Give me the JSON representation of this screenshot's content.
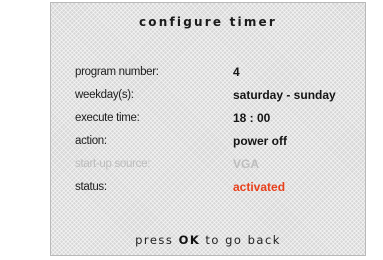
{
  "title": "configure timer",
  "rows": [
    {
      "label": "program number:",
      "value": "4"
    },
    {
      "label": "weekday(s):",
      "value": "saturday - sunday"
    },
    {
      "label": "execute time:",
      "value": "18 : 00"
    },
    {
      "label": "action:",
      "value": "power off"
    },
    {
      "label": "start-up source:",
      "value": "VGA"
    },
    {
      "label": "status:",
      "value": "activated"
    }
  ],
  "footer": {
    "prefix": "press",
    "key": "OK",
    "suffix": "to go back"
  },
  "colors": {
    "status_value": "#e8401c",
    "disabled_text": "#bdbdbd"
  }
}
